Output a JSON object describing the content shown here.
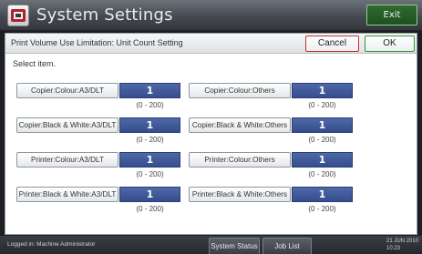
{
  "window": {
    "title": "System Settings",
    "exit_label": "Exit"
  },
  "header": {
    "title": "Print Volume Use Limitation: Unit Count Setting",
    "cancel_label": "Cancel",
    "ok_label": "OK"
  },
  "instruction": "Select item.",
  "settings": [
    {
      "label": "Copier:Colour:A3/DLT",
      "value": "1",
      "range": "(0 - 200)"
    },
    {
      "label": "Copier:Colour:Others",
      "value": "1",
      "range": "(0 - 200)"
    },
    {
      "label": "Copier:Black & White:A3/DLT",
      "value": "1",
      "range": "(0 - 200)"
    },
    {
      "label": "Copier:Black & White:Others",
      "value": "1",
      "range": "(0 - 200)"
    },
    {
      "label": "Printer:Colour:A3/DLT",
      "value": "1",
      "range": "(0 - 200)"
    },
    {
      "label": "Printer:Colour:Others",
      "value": "1",
      "range": "(0 - 200)"
    },
    {
      "label": "Printer:Black & White:A3/DLT",
      "value": "1",
      "range": "(0 - 200)"
    },
    {
      "label": "Printer:Black & White:Others",
      "value": "1",
      "range": "(0 - 200)"
    }
  ],
  "statusbar": {
    "logged_in": "Logged in: Machine Administrator",
    "system_status_label": "System Status",
    "job_list_label": "Job List",
    "date": "21 JUN 2010",
    "time": "10:23"
  },
  "colors": {
    "value_box": "#3d5597",
    "exit_border": "#8bd08b",
    "cancel_border": "#c03030",
    "ok_border": "#2d9a2d"
  },
  "icons": {
    "title": "settings-tool-icon"
  }
}
